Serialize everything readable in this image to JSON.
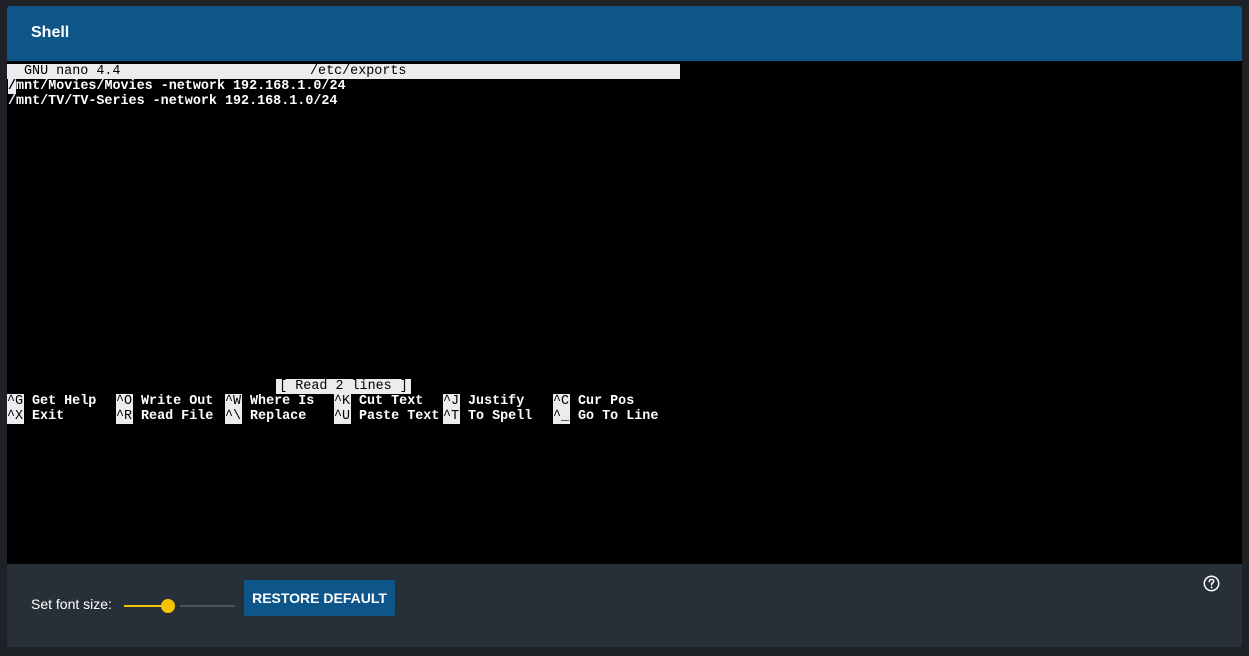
{
  "header": {
    "title": "Shell"
  },
  "terminal": {
    "nano_version": "GNU nano 4.4",
    "filename": "/etc/exports",
    "lines": [
      {
        "cursor_char": "/",
        "rest": "mnt/Movies/Movies -network 192.168.1.0/24"
      },
      {
        "cursor_char": "",
        "rest": "/mnt/TV/TV-Series -network 192.168.1.0/24"
      }
    ],
    "status": "[ Read 2 lines ]",
    "shortcuts": [
      {
        "key": "^G",
        "label": "Get Help"
      },
      {
        "key": "^O",
        "label": "Write Out"
      },
      {
        "key": "^W",
        "label": "Where Is"
      },
      {
        "key": "^K",
        "label": "Cut Text"
      },
      {
        "key": "^J",
        "label": "Justify"
      },
      {
        "key": "^C",
        "label": "Cur Pos"
      },
      {
        "key": "^X",
        "label": "Exit"
      },
      {
        "key": "^R",
        "label": "Read File"
      },
      {
        "key": "^\\",
        "label": "Replace"
      },
      {
        "key": "^U",
        "label": "Paste Text"
      },
      {
        "key": "^T",
        "label": "To Spell"
      },
      {
        "key": "^_",
        "label": "Go To Line"
      }
    ]
  },
  "footer": {
    "font_size_label": "Set font size:",
    "font_size_level": 0.4,
    "restore_label": "RESTORE DEFAULT"
  },
  "colors": {
    "header_bg": "#0e5689",
    "accent": "#f5c400",
    "terminal_bg": "#000000",
    "panel_bg": "#273038"
  },
  "icons": {
    "help": "help-circle-icon"
  }
}
